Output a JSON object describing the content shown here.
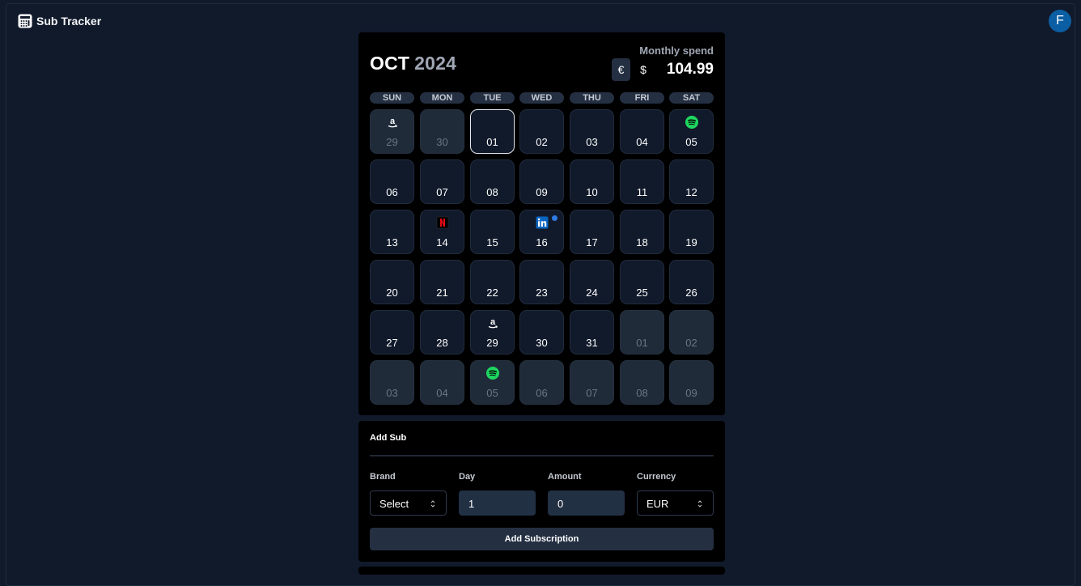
{
  "app": {
    "title": "Sub Tracker",
    "user_initial": "F"
  },
  "calendar": {
    "month": "OCT",
    "year": "2024",
    "spend_label": "Monthly spend",
    "currency_eur": "€",
    "currency_usd": "$",
    "spend_value": "104.99",
    "weekdays": [
      "SUN",
      "MON",
      "TUE",
      "WED",
      "THU",
      "FRI",
      "SAT"
    ],
    "days": [
      {
        "n": "29",
        "other": true,
        "icon": "amazon-icon"
      },
      {
        "n": "30",
        "other": true
      },
      {
        "n": "01",
        "today": true
      },
      {
        "n": "02"
      },
      {
        "n": "03"
      },
      {
        "n": "04"
      },
      {
        "n": "05",
        "icon": "spotify-icon"
      },
      {
        "n": "06"
      },
      {
        "n": "07"
      },
      {
        "n": "08"
      },
      {
        "n": "09"
      },
      {
        "n": "10"
      },
      {
        "n": "11"
      },
      {
        "n": "12"
      },
      {
        "n": "13"
      },
      {
        "n": "14",
        "icon": "netflix-icon"
      },
      {
        "n": "15"
      },
      {
        "n": "16",
        "icon": "linkedin-icon",
        "dot": true
      },
      {
        "n": "17"
      },
      {
        "n": "18"
      },
      {
        "n": "19"
      },
      {
        "n": "20"
      },
      {
        "n": "21"
      },
      {
        "n": "22"
      },
      {
        "n": "23"
      },
      {
        "n": "24"
      },
      {
        "n": "25"
      },
      {
        "n": "26"
      },
      {
        "n": "27"
      },
      {
        "n": "28"
      },
      {
        "n": "29",
        "icon": "amazon-icon"
      },
      {
        "n": "30"
      },
      {
        "n": "31"
      },
      {
        "n": "01",
        "other": true
      },
      {
        "n": "02",
        "other": true
      },
      {
        "n": "03",
        "other": true
      },
      {
        "n": "04",
        "other": true
      },
      {
        "n": "05",
        "other": true,
        "icon": "spotify-icon"
      },
      {
        "n": "06",
        "other": true
      },
      {
        "n": "07",
        "other": true
      },
      {
        "n": "08",
        "other": true
      },
      {
        "n": "09",
        "other": true
      }
    ]
  },
  "add_sub": {
    "title": "Add Sub",
    "brand_label": "Brand",
    "brand_value": "Select",
    "day_label": "Day",
    "day_value": "1",
    "amount_label": "Amount",
    "amount_value": "0",
    "currency_label": "Currency",
    "currency_value": "EUR",
    "submit_label": "Add Subscription"
  },
  "colors": {
    "background": "#111a2b",
    "card": "#000000",
    "spotify": "#1ed760",
    "linkedin": "#0a66c2",
    "netflix": "#e50914",
    "avatar": "#0b5ea3"
  }
}
